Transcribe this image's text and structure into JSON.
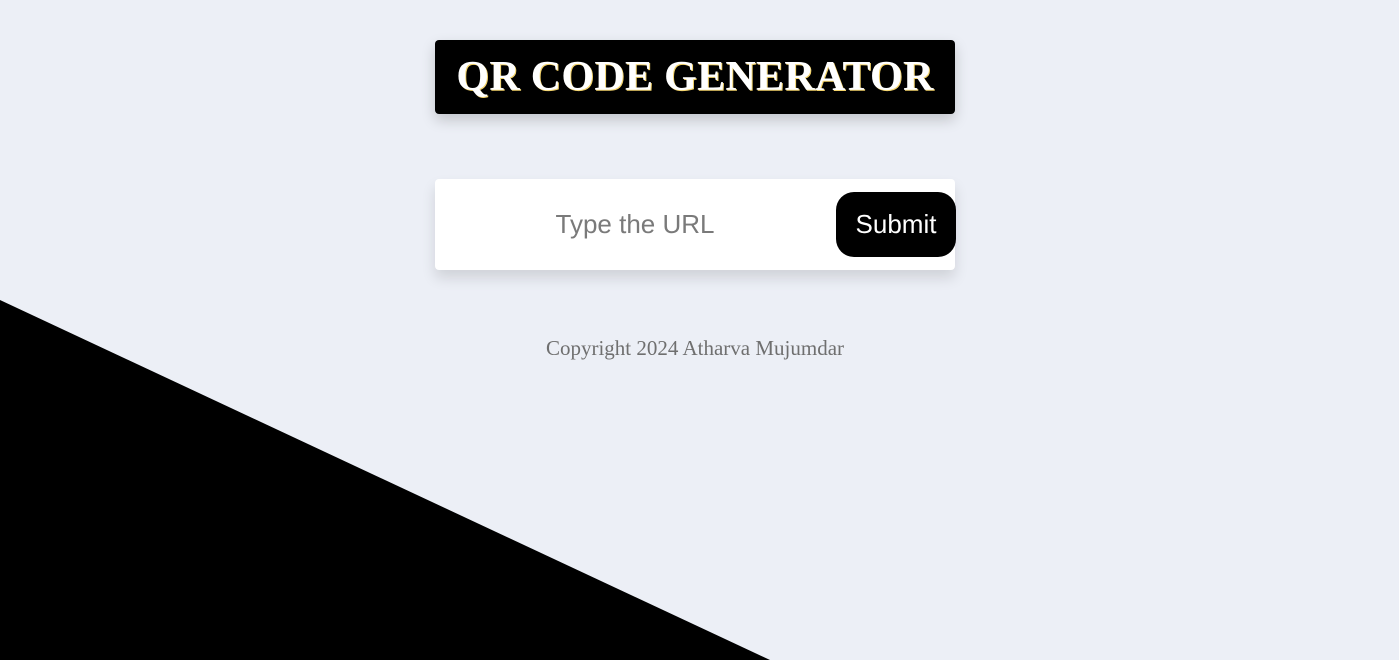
{
  "header": {
    "title": "QR CODE GENERATOR"
  },
  "form": {
    "url_placeholder": "Type the URL",
    "url_value": "",
    "submit_label": "Submit"
  },
  "footer": {
    "copyright": "Copyright 2024 Atharva Mujumdar"
  },
  "colors": {
    "background": "#eceff6",
    "accent": "#000000",
    "card": "#ffffff",
    "muted_text": "#6f6f6f"
  }
}
